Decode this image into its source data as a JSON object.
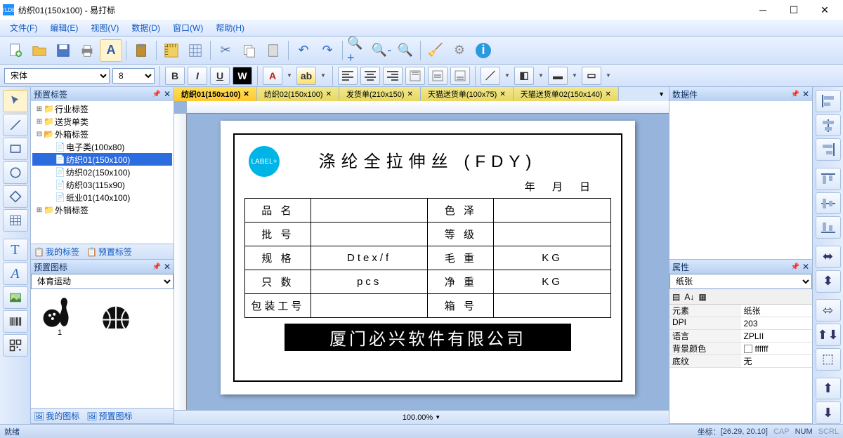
{
  "window": {
    "title": "纺织01(150x100) - 易打标",
    "logo_text": "YLDB"
  },
  "menu": [
    "文件(F)",
    "编辑(E)",
    "视图(V)",
    "数据(D)",
    "窗口(W)",
    "帮助(H)"
  ],
  "font_combo": {
    "family": "宋体",
    "size": "8"
  },
  "left_panel1": {
    "title": "预置标签",
    "foot_a": "我的标签",
    "foot_b": "预置标签"
  },
  "tree": {
    "n0": "行业标签",
    "n1": "送货单类",
    "n2": "外箱标签",
    "n2_0": "电子类(100x80)",
    "n2_1": "纺织01(150x100)",
    "n2_2": "纺织02(150x100)",
    "n2_3": "纺织03(115x90)",
    "n2_4": "纸业01(140x100)",
    "n3": "外销标签"
  },
  "left_panel2": {
    "title": "预置图标",
    "combo": "体育运动",
    "foot_a": "我的图标",
    "foot_b": "预置图标",
    "item1": "1"
  },
  "tabs": [
    {
      "label": "纺织01(150x100)",
      "active": true
    },
    {
      "label": "纺织02(150x100)",
      "active": false
    },
    {
      "label": "发货单(210x150)",
      "active": false
    },
    {
      "label": "天猫送货单(100x75)",
      "active": false
    },
    {
      "label": "天猫送货单02(150x140)",
      "active": false
    }
  ],
  "label": {
    "logo": "LABEL+",
    "title": "涤纶全拉伸丝 (FDY)",
    "date": "年 月 日",
    "r0c0": "品 名",
    "r0c2": "色 泽",
    "r1c0": "批 号",
    "r1c2": "等 级",
    "r2c0": "规 格",
    "r2c1": "Dtex/f",
    "r2c2": "毛 重",
    "r2c3": "KG",
    "r3c0": "只 数",
    "r3c1": "pcs",
    "r3c2": "净 重",
    "r3c3": "KG",
    "r4c0": "包装工号",
    "r4c2": "箱 号",
    "company": "厦门必兴软件有限公司"
  },
  "zoom": "100.00%",
  "right_panel1": {
    "title": "数据件"
  },
  "right_panel2": {
    "title": "属性",
    "combo": "纸张",
    "rows": [
      {
        "k": "元素",
        "v": "纸张"
      },
      {
        "k": "DPI",
        "v": "203"
      },
      {
        "k": "语言",
        "v": "ZPLII"
      },
      {
        "k": "背景颜色",
        "v": "ffffff",
        "swatch": true
      },
      {
        "k": "底纹",
        "v": "无"
      }
    ]
  },
  "status": {
    "ready": "就绪",
    "coord_label": "坐标：",
    "coord": "[26.29, 20.10]",
    "cap": "CAP",
    "num": "NUM",
    "scrl": "SCRL"
  }
}
